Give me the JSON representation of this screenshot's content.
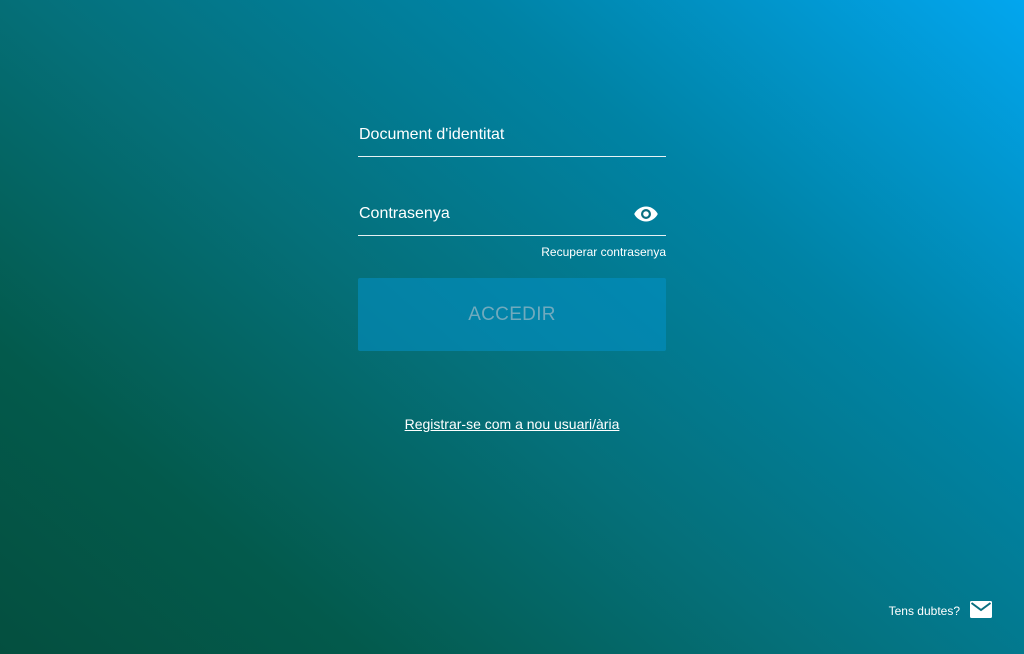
{
  "login": {
    "document_placeholder": "Document d'identitat",
    "password_placeholder": "Contrasenya",
    "toggle_visibility_icon": "eye-icon",
    "forgot_password": "Recuperar contrasenya",
    "submit_label": "ACCEDIR"
  },
  "register": {
    "label": "Registrar-se com a nou usuari/ària"
  },
  "help": {
    "label": "Tens dubtes?",
    "icon": "mail-icon"
  },
  "colors": {
    "gradient_dark": "#044f3f",
    "gradient_light": "#02a6ef",
    "button_bg": "#0492c8"
  }
}
